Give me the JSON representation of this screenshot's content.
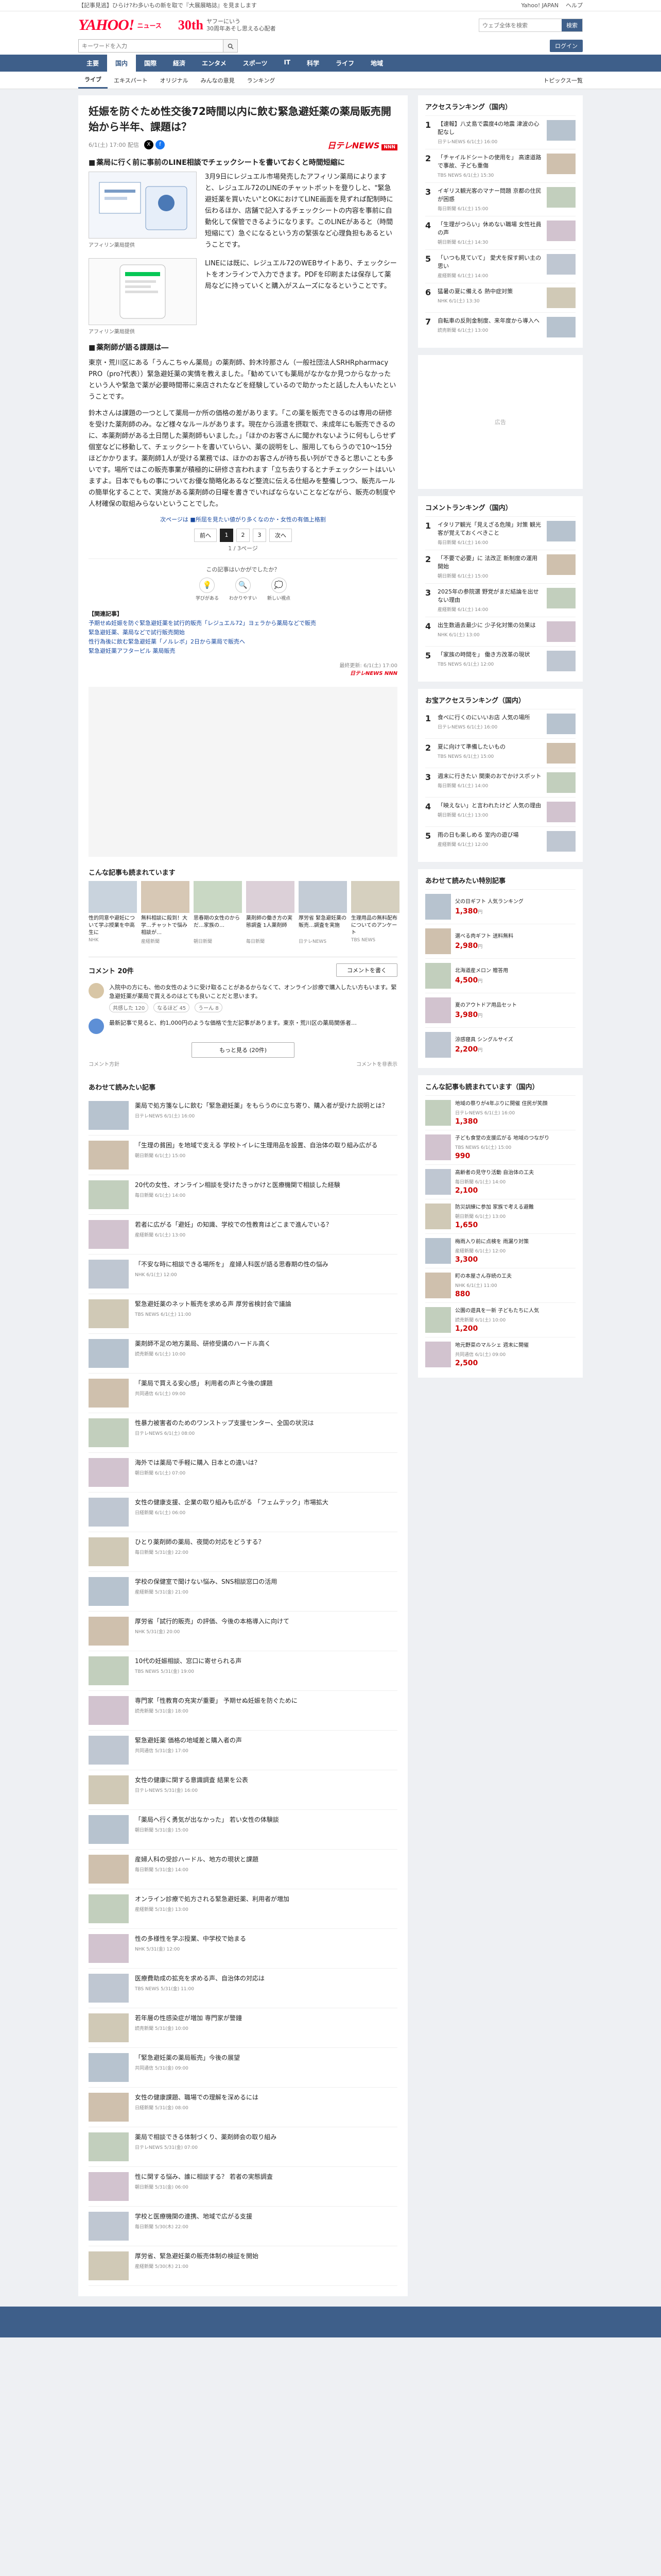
{
  "topbar": {
    "promo": "【記事見逃】ひらけ?わ多いもの新を取で『大展展略誌』を見まします",
    "links": [
      "Yahoo! JAPAN",
      "ヘルプ"
    ]
  },
  "header": {
    "logo": "YAHOO!",
    "logo_sub": "ニュース",
    "anniv_num": "30th",
    "anniv_text": "ヤフーにいう\n30周年あそし思える心配者",
    "search_placeholder": "ウェブ全体を検索",
    "search_button": "検索"
  },
  "searchrow": {
    "placeholder": "キーワードを入力",
    "links": [
      "ログイン"
    ]
  },
  "nav": {
    "items": [
      "主要",
      "国内",
      "国際",
      "経済",
      "エンタメ",
      "スポーツ",
      "IT",
      "科学",
      "ライフ",
      "地域"
    ]
  },
  "subnav": {
    "items": [
      "ライブ",
      "エキスパート",
      "オリジナル",
      "みんなの意見",
      "ランキング"
    ],
    "topics": "トピックス一覧"
  },
  "article": {
    "title": "妊娠を防ぐため性交後72時間以内に飲む緊急避妊薬の薬局販売開始から半年、課題は？",
    "date": "6/1(土) 17:00 配信",
    "publisher": "日テレNEWS",
    "publisher_badge": "NNN",
    "section1": "薬局に行く前に事前のLINE相談でチェックシートを書いておくと時間短縮に",
    "figure1_caption": "アフィリン薬局提供",
    "figure1_text": "3月9日にレジュエル市場発売したアフィリン薬局によりますと、レジュエル72のLINEのチャットボットを登りしと、\"緊急避妊薬を買いたい\"とOKにおけてLINE画面を見ずれば配制時に伝わるほか、店舗で記入するチェックシートの内容を事前に自動化して保管できるようになります。このLINEがあると（時間短縮にて）急ぐになるという方の緊張など心理負担もあるということです。",
    "figure2_caption": "アフィリン薬局提供",
    "figure2_text": "LINEには既に、レジュエル72のWEBサイトあり、チェックシートをオンラインで入力できます。PDFを印刷または保存して薬局などに持っていくと購入がスムーズになるということです。",
    "section2": "薬剤師が語る課題は―",
    "para1": "東京・荒川区にある「うんこちゃん薬局」の薬剤師、鈴木玲那さん（一般社団法人SRHRpharmacy PRO（pro?代表））緊急避妊薬の実情を教えました。「勧めていても薬局がなかなか見つからなかったという人や緊急で薬が必要時間帯に来店されたなどを経験しているので助かったと話した人もいたということです。",
    "para2": "鈴木さんは課題の一つとして薬局一か所の価格の差があります。「この薬を販売できるのは専用の研修を受けた薬剤師のみ。など様々なルールがあります。現在から派遣を摂取で、未成年にも販売できるのに、本薬剤師がある土日閉した薬剤師もいました。」「ほかのお客さんに聞かれないように何もしらせず個室などに移動して、チェックシートを書いていらい、薬の説明をし、服用してもらうので10〜15分ほどかかります。薬剤師1人が受ける業務では、ほかのお客さんが待ち長い列ができると思いことも多いです。場所ではこの販売事業が積極的に研修さ言われます「立ち去りするとナチェックシートはいいますよ。日本でももの事についてお優な簡略化あるなど整流に伝える仕組みを整備しつつ、販売ルールの簡単化することで、実施がある薬剤師の日曜を書きでいればならないことなどながら、販売の制度や人材確保の取組みらないということでした。",
    "related": "次ページは ■所屈を見たい値がり多くなのか・女性の有価上格割",
    "pager_prev": "前へ",
    "pager_pages": [
      "1",
      "2",
      "3"
    ],
    "pager_next": "次へ",
    "pager_count": "1 / 3ページ",
    "reaction_question": "この記事はいかがでしたか？",
    "reactions": [
      {
        "icon": "💡",
        "label": "学びがある"
      },
      {
        "icon": "🔍",
        "label": "わかりやすい"
      },
      {
        "icon": "💭",
        "label": "新しい視点"
      }
    ],
    "links_head": "【関連記事】",
    "links": [
      "予期せぬ妊娠を防ぐ緊急避妊薬を試行的販売「レジュエル72」ヨェラから薬局などで販売",
      "緊急避妊薬、薬局などで試行販売開始",
      "性行為後に飲む緊急避妊薬「ノルレボ」2日から薬局で販売へ",
      "緊急避妊薬アフターピル 薬局販売"
    ],
    "source_date": "最終更新: 6/1(土) 17:00",
    "source_pub": "日テレNEWS NNN"
  },
  "recommend": {
    "title": "こんな記事も読まれています",
    "items": [
      {
        "t": "性的同意や避妊について学ぶ授業を中高生に",
        "s": "NHK"
      },
      {
        "t": "無料相談に殺到！大学…チャットで悩み相談が…",
        "s": "産経新聞"
      },
      {
        "t": "思春期の女性のからだ…家族の…",
        "s": "朝日新聞"
      },
      {
        "t": "薬剤師の働き方の実態調査 1人薬剤師",
        "s": "毎日新聞"
      },
      {
        "t": "厚労省 緊急避妊薬の販売…調査を実施",
        "s": "日テレNEWS"
      },
      {
        "t": "生理用品の無料配布についてのアンケート",
        "s": "TBS NEWS"
      }
    ]
  },
  "comments": {
    "count": "コメント 20件",
    "write": "コメントを書く",
    "first": "入院中の方にも、他の女性のように受け取ることがあるからなくて、オンライン診療で購入したい方もいます。緊急避妊薬が薬局で買えるのはとても良いことだと思います。",
    "first_reactions": [
      "共感した 120",
      "なるほど 45",
      "うーん 8"
    ],
    "ai": "最新記事で見ると、約1,000円のような価格で生だ記事があります。東京・荒川区の薬局関係者…",
    "more": "もっと見る (20件)",
    "note_left": "コメント方針",
    "note_right": "コメントを非表示"
  },
  "readalso": {
    "title": "あわせて読みたい記事",
    "items": [
      {
        "t": "薬局で処方箋なしに飲む「緊急避妊薬」をもらうのに立ち寄り、購入者が受けた説明とは？",
        "s": "日テレNEWS 6/1(土) 16:00"
      },
      {
        "t": "「生理の貧困」を地域で支える 学校トイレに生理用品を設置、自治体の取り組み広がる",
        "s": "朝日新聞 6/1(土) 15:00"
      },
      {
        "t": "20代の女性、オンライン相談を受けたきっかけと医療機関で相談した経験",
        "s": "毎日新聞 6/1(土) 14:00"
      },
      {
        "t": "若者に広がる「避妊」の知識、学校での性教育はどこまで進んでいる？",
        "s": "産経新聞 6/1(土) 13:00"
      },
      {
        "t": "「不安な時に相談できる場所を」 産婦人科医が語る思春期の性の悩み",
        "s": "NHK 6/1(土) 12:00"
      },
      {
        "t": "緊急避妊薬のネット販売を求める声 厚労省検討会で議論",
        "s": "TBS NEWS 6/1(土) 11:00"
      },
      {
        "t": "薬剤師不足の地方薬局、研修受講のハードル高く",
        "s": "読売新聞 6/1(土) 10:00"
      },
      {
        "t": "「薬局で買える安心感」 利用者の声と今後の課題",
        "s": "共同通信 6/1(土) 09:00"
      },
      {
        "t": "性暴力被害者のためのワンストップ支援センター、全国の状況は",
        "s": "日テレNEWS 6/1(土) 08:00"
      },
      {
        "t": "海外では薬局で手軽に購入 日本との違いは？",
        "s": "朝日新聞 6/1(土) 07:00"
      },
      {
        "t": "女性の健康支援、企業の取り組みも広がる 「フェムテック」市場拡大",
        "s": "日経新聞 6/1(土) 06:00"
      },
      {
        "t": "ひとり薬剤師の薬局、夜間の対応をどうする？",
        "s": "毎日新聞 5/31(金) 22:00"
      },
      {
        "t": "学校の保健室で聞けない悩み、SNS相談窓口の活用",
        "s": "産経新聞 5/31(金) 21:00"
      },
      {
        "t": "厚労省「試行的販売」の評価、今後の本格導入に向けて",
        "s": "NHK 5/31(金) 20:00"
      },
      {
        "t": "10代の妊娠相談、窓口に寄せられる声",
        "s": "TBS NEWS 5/31(金) 19:00"
      },
      {
        "t": "専門家「性教育の充実が重要」 予期せぬ妊娠を防ぐために",
        "s": "読売新聞 5/31(金) 18:00"
      },
      {
        "t": "緊急避妊薬 価格の地域差と購入者の声",
        "s": "共同通信 5/31(金) 17:00"
      },
      {
        "t": "女性の健康に関する意識調査 結果を公表",
        "s": "日テレNEWS 5/31(金) 16:00"
      },
      {
        "t": "「薬局へ行く勇気が出なかった」 若い女性の体験談",
        "s": "朝日新聞 5/31(金) 15:00"
      },
      {
        "t": "産婦人科の受診ハードル、地方の現状と課題",
        "s": "毎日新聞 5/31(金) 14:00"
      },
      {
        "t": "オンライン診療で処方される緊急避妊薬、利用者が増加",
        "s": "産経新聞 5/31(金) 13:00"
      },
      {
        "t": "性の多様性を学ぶ授業、中学校で始まる",
        "s": "NHK 5/31(金) 12:00"
      },
      {
        "t": "医療費助成の拡充を求める声、自治体の対応は",
        "s": "TBS NEWS 5/31(金) 11:00"
      },
      {
        "t": "若年層の性感染症が増加 専門家が警鐘",
        "s": "読売新聞 5/31(金) 10:00"
      },
      {
        "t": "「緊急避妊薬の薬局販売」今後の展望",
        "s": "共同通信 5/31(金) 09:00"
      },
      {
        "t": "女性の健康課題、職場での理解を深めるには",
        "s": "日経新聞 5/31(金) 08:00"
      },
      {
        "t": "薬局で相談できる体制づくり、薬剤師会の取り組み",
        "s": "日テレNEWS 5/31(金) 07:00"
      },
      {
        "t": "性に関する悩み、誰に相談する？ 若者の実態調査",
        "s": "朝日新聞 5/31(金) 06:00"
      },
      {
        "t": "学校と医療機関の連携、地域で広がる支援",
        "s": "毎日新聞 5/30(木) 22:00"
      },
      {
        "t": "厚労省、緊急避妊薬の販売体制の検証を開始",
        "s": "産経新聞 5/30(木) 21:00"
      }
    ]
  },
  "side": {
    "access_title": "アクセスランキング（国内）",
    "access": [
      {
        "t": "【速報】八丈島で震度4の地震 津波の心配なし",
        "s": "日テレNEWS 6/1(土) 16:00"
      },
      {
        "t": "「チャイルドシートの使用を」 高速道路で事故、子ども重傷",
        "s": "TBS NEWS 6/1(土) 15:30"
      },
      {
        "t": "イギリス観光客のマナー問題 京都の住民が困惑",
        "s": "毎日新聞 6/1(土) 15:00"
      },
      {
        "t": "「生理がつらい」休めない職場 女性社員の声",
        "s": "朝日新聞 6/1(土) 14:30"
      },
      {
        "t": "「いつも見ていて」 愛犬を探す飼い主の思い",
        "s": "産経新聞 6/1(土) 14:00"
      },
      {
        "t": "猛暑の夏に備える 熱中症対策",
        "s": "NHK 6/1(土) 13:30"
      },
      {
        "t": "自転車の反則金制度、来年度から導入へ",
        "s": "読売新聞 6/1(土) 13:00"
      }
    ],
    "ad_text": "広告",
    "comment_title": "コメントランキング（国内）",
    "comments": [
      {
        "t": "イタリア観光「見えざる危険」対策 観光客が覚えておくべきこと",
        "s": "毎日新聞 6/1(土) 16:00"
      },
      {
        "t": "「不要で必要」に 法改正 新制度の運用開始",
        "s": "朝日新聞 6/1(土) 15:00"
      },
      {
        "t": "2025年の参院選 野党がまだ結論を出せない理由",
        "s": "産経新聞 6/1(土) 14:00"
      },
      {
        "t": "出生数過去最少に 少子化対策の効果は",
        "s": "NHK 6/1(土) 13:00"
      },
      {
        "t": "「家族の時間を」 働き方改革の現状",
        "s": "TBS NEWS 6/1(土) 12:00"
      }
    ],
    "gift_title": "お宝アクセスランキング（国内）",
    "gift": [
      {
        "t": "食べに行くのにいいお店 人気の場所",
        "s": "日テレNEWS 6/1(土) 16:00"
      },
      {
        "t": "夏に向けて準備したいもの",
        "s": "TBS NEWS 6/1(土) 15:00"
      },
      {
        "t": "週末に行きたい 関東のおでかけスポット",
        "s": "毎日新聞 6/1(土) 14:00"
      },
      {
        "t": "「映えない」と言われたけど 人気の理由",
        "s": "朝日新聞 6/1(土) 13:00"
      },
      {
        "t": "雨の日も楽しめる 室内の遊び場",
        "s": "産経新聞 6/1(土) 12:00"
      }
    ],
    "sale_title": "あわせて読みたい特別記事",
    "sales": [
      {
        "t": "父の日ギフト 人気ランキング",
        "p": "1,380",
        "u": "円"
      },
      {
        "t": "選べる肉ギフト 送料無料",
        "p": "2,980",
        "u": "円"
      },
      {
        "t": "北海道産メロン 贈答用",
        "p": "4,500",
        "u": "円"
      },
      {
        "t": "夏のアウトドア用品セット",
        "p": "3,980",
        "u": "円"
      },
      {
        "t": "涼感寝具 シングルサイズ",
        "p": "2,200",
        "u": "円"
      }
    ],
    "bottom_title": "こんな記事も読まれています（国内）",
    "bottom": [
      {
        "t": "地域の祭りが4年ぶりに開催 住民が笑顔",
        "s": "日テレNEWS 6/1(土) 16:00"
      },
      {
        "t": "子ども食堂の支援広がる 地域のつながり",
        "s": "TBS NEWS 6/1(土) 15:00"
      },
      {
        "t": "高齢者の見守り活動 自治体の工夫",
        "s": "毎日新聞 6/1(土) 14:00"
      },
      {
        "t": "防災訓練に参加 家族で考える避難",
        "s": "朝日新聞 6/1(土) 13:00"
      },
      {
        "t": "梅雨入り前に点検を 雨漏り対策",
        "s": "産経新聞 6/1(土) 12:00"
      },
      {
        "t": "町の本屋さん存続の工夫",
        "s": "NHK 6/1(土) 11:00"
      },
      {
        "t": "公園の遊具を一新 子どもたちに人気",
        "s": "読売新聞 6/1(土) 10:00"
      },
      {
        "t": "地元野菜のマルシェ 週末に開催",
        "s": "共同通信 6/1(土) 09:00"
      }
    ],
    "bottom_prices": [
      "1,380",
      "990",
      "2,100",
      "1,650",
      "3,300",
      "880",
      "1,200",
      "2,500"
    ]
  },
  "colors": {
    "brand": "#ff0033",
    "nav": "#3e5f8a",
    "publisher": "#e60012"
  }
}
